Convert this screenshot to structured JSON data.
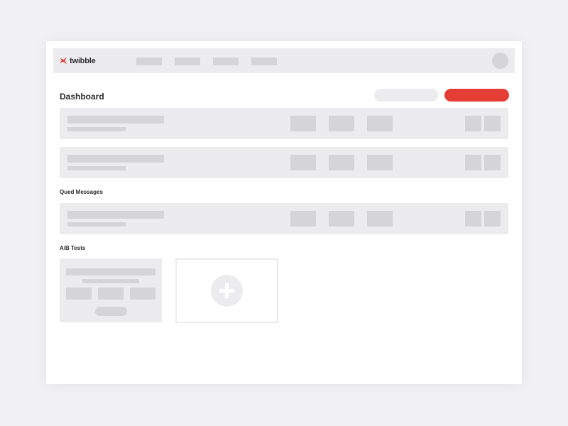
{
  "app": {
    "name": "twibble"
  },
  "colors": {
    "background": "#f1f0f2",
    "surface": "#ffffff",
    "panel": "#ececee",
    "placeholder": "#d5d4d6",
    "accent": "#e53e34"
  },
  "header": {
    "logo_icon": "twibble-bird-icon",
    "nav_items": [
      "",
      "",
      "",
      ""
    ],
    "avatar_icon": "user-avatar"
  },
  "page": {
    "title": "Dashboard"
  },
  "sections": {
    "queued_messages": {
      "label": "Qued Messages"
    },
    "ab_tests": {
      "label": "A/B Tests",
      "add_icon": "plus-icon"
    }
  }
}
